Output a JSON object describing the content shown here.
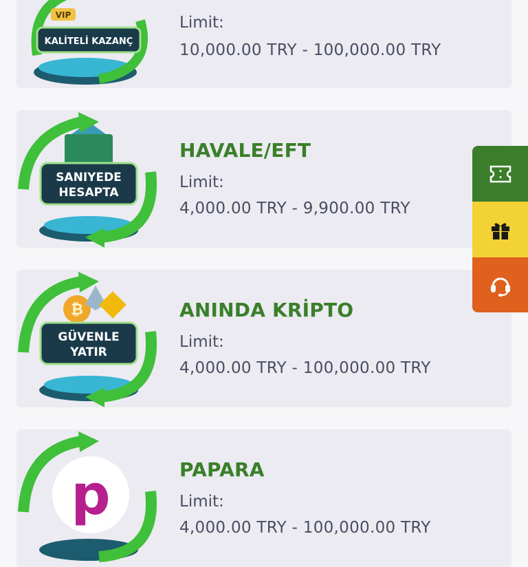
{
  "methods": [
    {
      "badge_top": "VIP",
      "badge_text": "KALİTELİ KAZANÇ",
      "title": "",
      "limit_label": "Limit:",
      "limit_value": "10,000.00 TRY - 100,000.00 TRY"
    },
    {
      "badge_text_line1": "SANIYEDE",
      "badge_text_line2": "HESAPTA",
      "title": "HAVALE/EFT",
      "limit_label": "Limit:",
      "limit_value": "4,000.00 TRY - 9,900.00 TRY"
    },
    {
      "badge_text_line1": "GÜVENLE",
      "badge_text_line2": "YATIR",
      "title": "ANINDA KRİPTO",
      "limit_label": "Limit:",
      "limit_value": "4,000.00 TRY - 100,000.00 TRY"
    },
    {
      "badge_letter": "p",
      "title": "PAPARA",
      "limit_label": "Limit:",
      "limit_value": "4,000.00 TRY - 100,000.00 TRY"
    }
  ],
  "side_buttons": [
    {
      "icon": "ticket-icon",
      "color": "#3b7d2b"
    },
    {
      "icon": "gift-icon",
      "color": "#f3d235"
    },
    {
      "icon": "headset-icon",
      "color": "#e0601e"
    }
  ],
  "colors": {
    "title_green": "#3a7f2a",
    "text_gray": "#4a4d63",
    "card_bg": "#ebebf1"
  }
}
